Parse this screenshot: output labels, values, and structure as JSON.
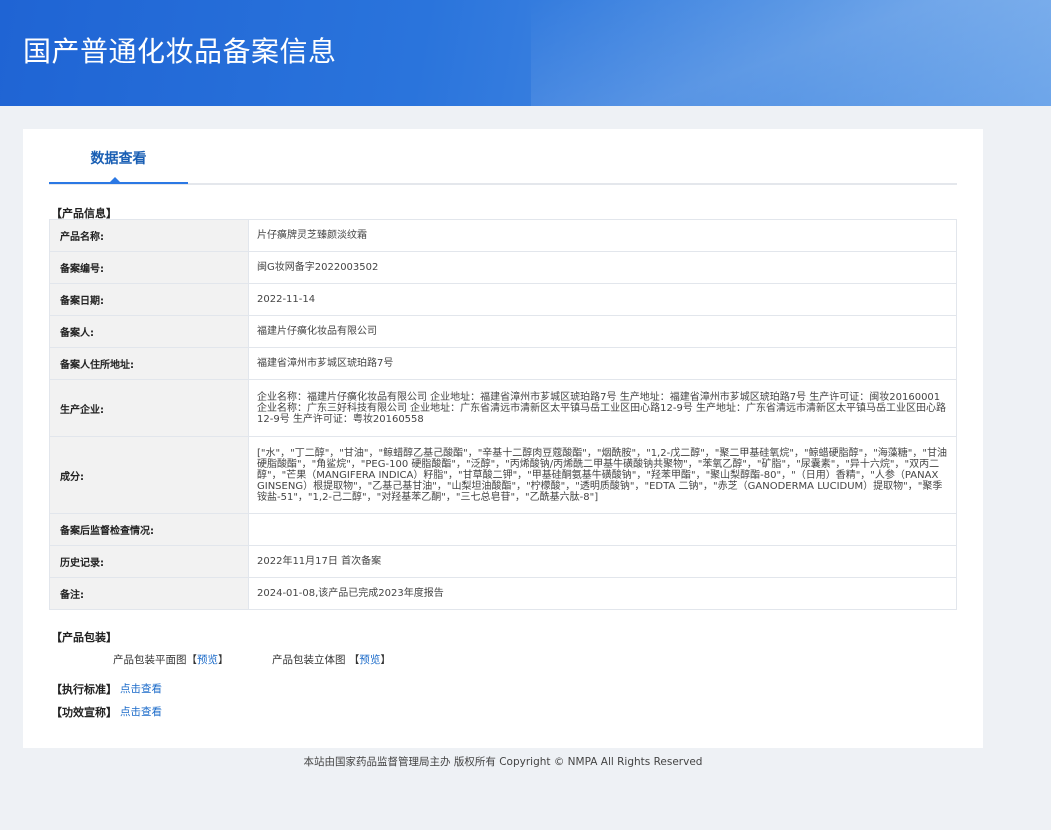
{
  "header": {
    "title": "国产普通化妆品备案信息"
  },
  "tabs": {
    "active": "数据查看"
  },
  "product_info": {
    "section_label": "【产品信息】",
    "rows": [
      {
        "label": "产品名称:",
        "value": "片仔癀牌灵芝臻颜淡纹霜"
      },
      {
        "label": "备案编号:",
        "value": "闽G妆网备字2022003502"
      },
      {
        "label": "备案日期:",
        "value": "2022-11-14"
      },
      {
        "label": "备案人:",
        "value": "福建片仔癀化妆品有限公司"
      },
      {
        "label": "备案人住所地址:",
        "value": "福建省漳州市芗城区琥珀路7号"
      },
      {
        "label": "生产企业:",
        "value": "企业名称：福建片仔癀化妆品有限公司 企业地址：福建省漳州市芗城区琥珀路7号 生产地址：福建省漳州市芗城区琥珀路7号 生产许可证：闽妆20160001 企业名称：广东三好科技有限公司 企业地址：广东省清远市清新区太平镇马岳工业区田心路12-9号 生产地址：广东省清远市清新区太平镇马岳工业区田心路12-9号 生产许可证：粤妆20160558"
      },
      {
        "label": "成分:",
        "value": "[\"水\"，\"丁二醇\"，\"甘油\"，\"鲸蜡醇乙基己酸酯\"，\"辛基十二醇肉豆蔻酸酯\"，\"烟酰胺\"，\"1,2-戊二醇\"，\"聚二甲基硅氧烷\"，\"鲸蜡硬脂醇\"，\"海藻糖\"，\"甘油硬脂酸酯\"，\"角鲨烷\"，\"PEG-100 硬脂酸酯\"，\"泛醇\"，\"丙烯酸钠/丙烯酰二甲基牛磺酸钠共聚物\"，\"苯氧乙醇\"，\"矿脂\"，\"尿囊素\"，\"异十六烷\"，\"双丙二醇\"，\"芒果（MANGIFERA INDICA）籽脂\"，\"甘草酸二钾\"，\"甲基硅酮氨基牛磺酸钠\"，\"羟苯甲酯\"，\"聚山梨醇酯-80\"，\"（日用）香精\"，\"人参（PANAX GINSENG）根提取物\"，\"乙基己基甘油\"，\"山梨坦油酸酯\"，\"柠檬酸\"，\"透明质酸钠\"，\"EDTA 二钠\"，\"赤芝（GANODERMA LUCIDUM）提取物\"，\"聚季铵盐-51\"，\"1,2-己二醇\"，\"对羟基苯乙酮\"，\"三七总皂苷\"，\"乙酰基六肽-8\"]"
      },
      {
        "label": "备案后监督检查情况:",
        "value": ""
      },
      {
        "label": "历史记录:",
        "value": "2022年11月17日 首次备案"
      },
      {
        "label": "备注:",
        "value": "2024-01-08,该产品已完成2023年度报告"
      }
    ]
  },
  "packaging": {
    "section_label": "【产品包装】",
    "flat_label": "产品包装平面图",
    "solid_label": "产品包装立体图",
    "preview_label": "预览"
  },
  "standard": {
    "label": "【执行标准】",
    "link": "点击查看"
  },
  "efficacy": {
    "label": "【功效宣称】",
    "link": "点击查看"
  },
  "footer": {
    "text": "本站由国家药品监督管理局主办 版权所有 Copyright © NMPA All Rights Reserved"
  }
}
